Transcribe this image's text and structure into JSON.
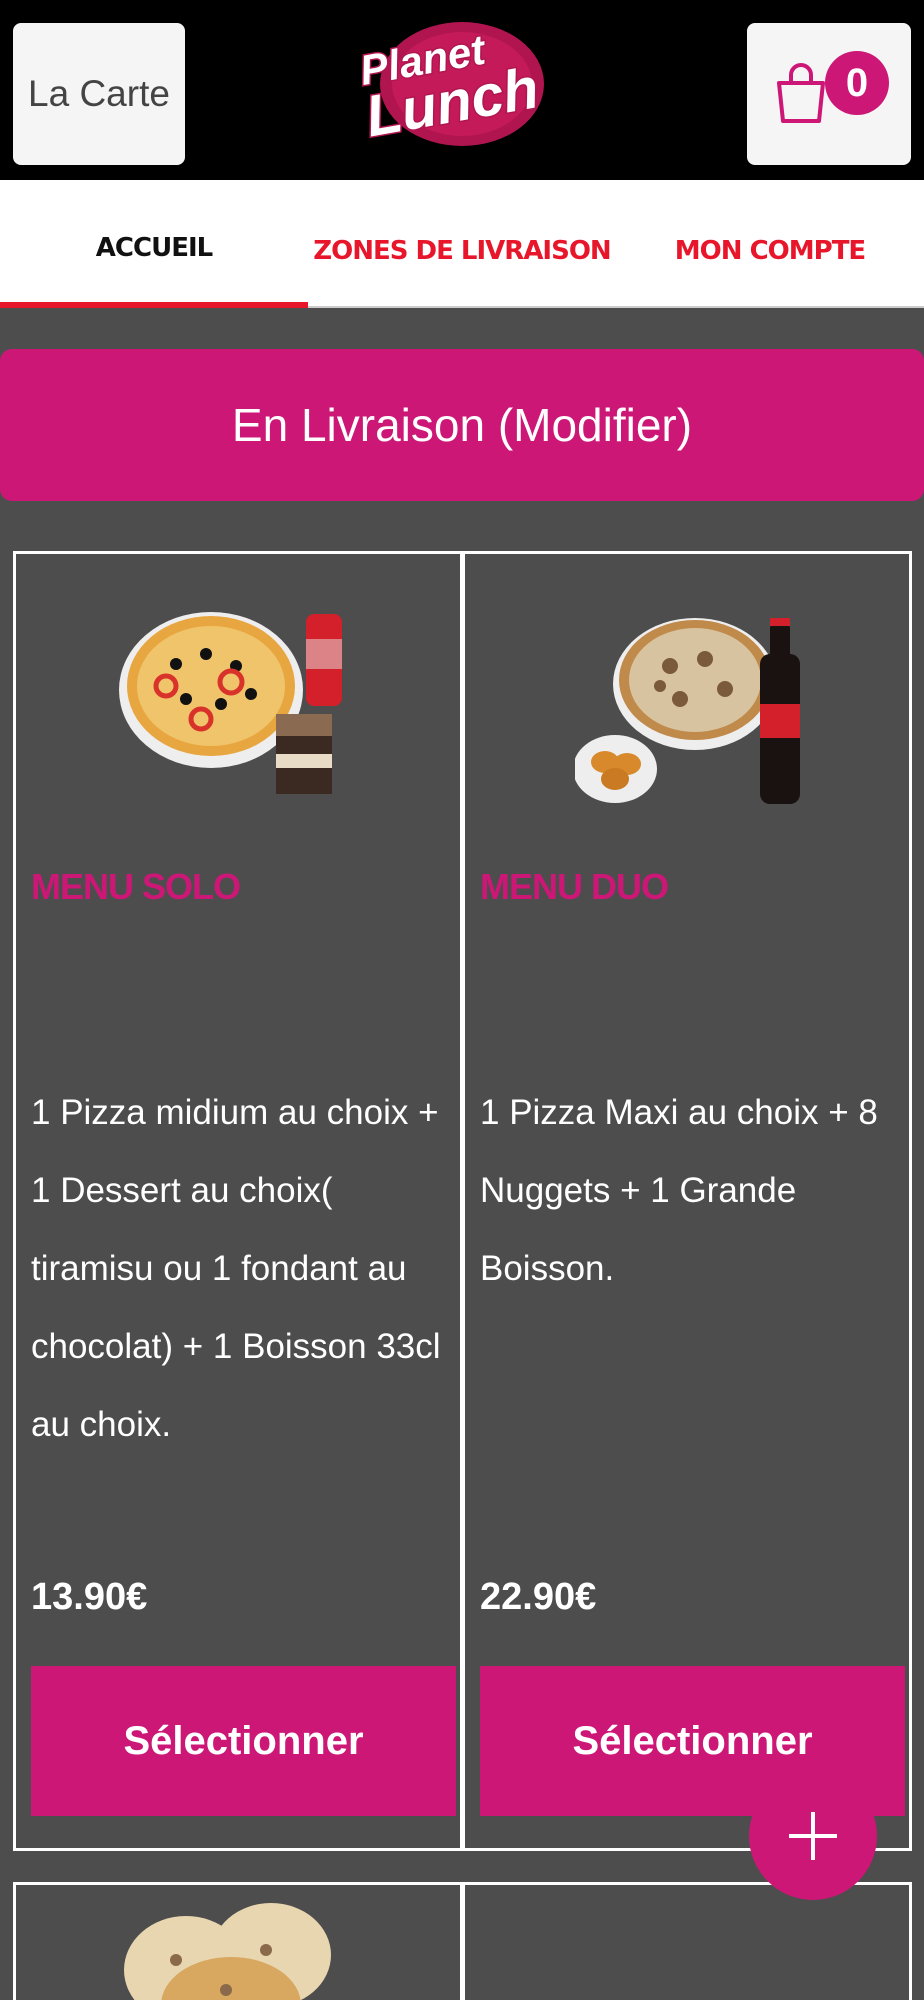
{
  "header": {
    "menu_label": "La Carte",
    "logo_text_line1": "Planet",
    "logo_text_line2": "Lunch",
    "cart_count": "0"
  },
  "tabs": [
    {
      "label": "ACCUEIL",
      "active": true
    },
    {
      "label": "ZONES DE LIVRAISON",
      "active": false
    },
    {
      "label": "MON COMPTE",
      "active": false
    }
  ],
  "delivery": {
    "label": "En Livraison (Modifier)"
  },
  "products": [
    {
      "title": "MENU SOLO",
      "description": "1 Pizza midium au choix + 1 Dessert au choix( tiramisu ou 1 fondant au chocolat) + 1 Boisson 33cl au choix.",
      "price": "13.90€",
      "button": "Sélectionner"
    },
    {
      "title": "MENU DUO",
      "description": "1 Pizza Maxi au choix + 8 Nuggets + 1 Grande Boisson.",
      "price": "22.90€",
      "button": "Sélectionner"
    }
  ],
  "colors": {
    "accent": "#cc1777",
    "tab_red": "#e8162b",
    "background": "#4d4d4d",
    "header_bg": "#000000"
  },
  "icons": {
    "cart": "shopping-bag-icon",
    "fab": "plus-icon"
  }
}
